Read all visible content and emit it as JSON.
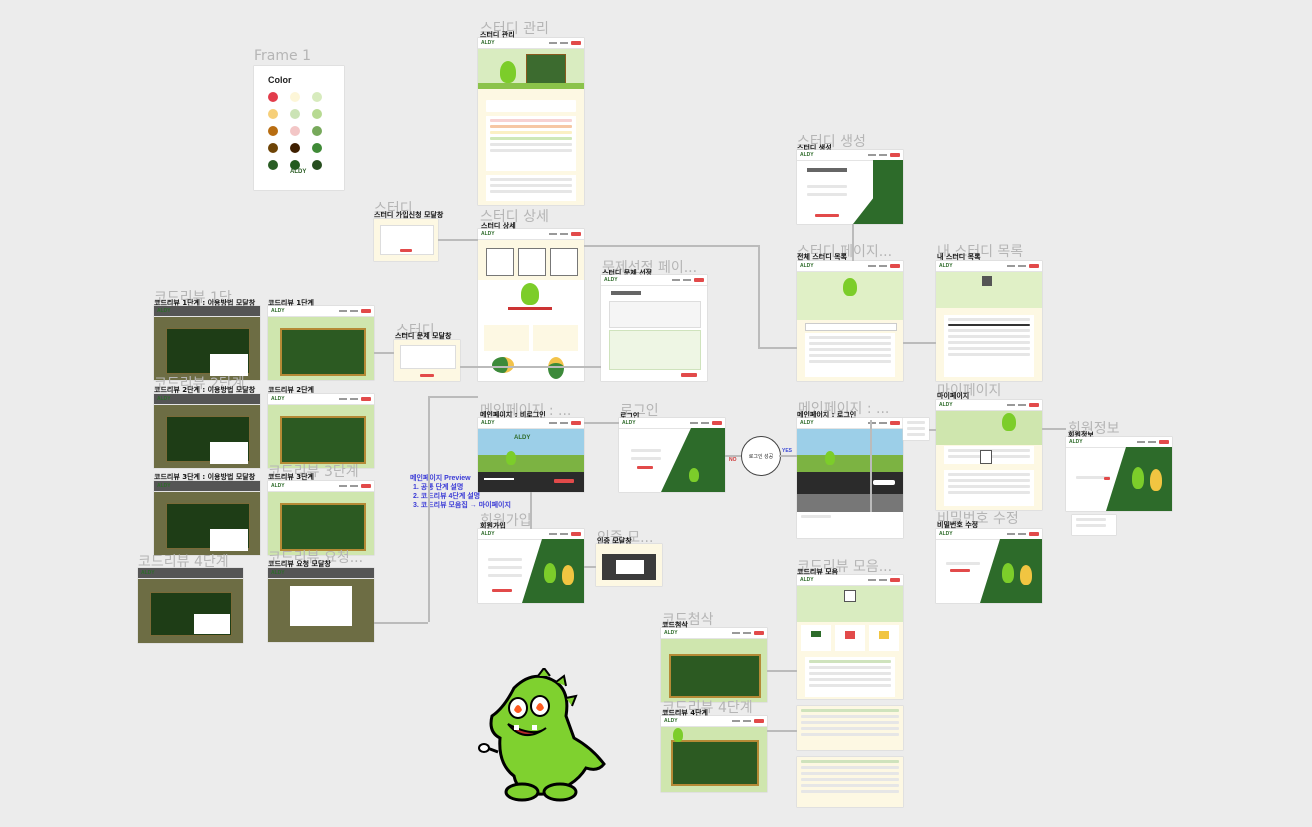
{
  "frame1": {
    "title": "Frame 1",
    "color_label": "Color",
    "brand": "ALDY",
    "swatches": [
      [
        "#e23c4b",
        "#fdf6d8",
        "#d7ebbd"
      ],
      [
        "#f6cf79",
        "#cbe3b5",
        "#b7da92"
      ],
      [
        "#b86d11",
        "#f3c6c6",
        "#77a95b"
      ],
      [
        "#6e4406",
        "#3f1f00",
        "#3f8a36"
      ],
      [
        "#2a5d24",
        "#235a1e",
        "#274e1f"
      ]
    ]
  },
  "ghost": {
    "study_manage": "스터디 관리",
    "study_join": "스터디",
    "study_detail": "스터디 상세",
    "problem_select": "문제선정 페이...",
    "study_create": "스터디 생성",
    "study_page": "스터디 페이지...",
    "my_study": "내 스터디 목록",
    "mypage": "마이페이지",
    "main_before": "메인페이지 : ...",
    "login": "로그인",
    "main_after": "메인페이지 : ...",
    "member_info": "회원정보",
    "signup": "회원가입",
    "auth": "인증 모...",
    "pw": "비밀번호 수정",
    "review_collection": "코드리뷰 모음...",
    "code_review_1": "코드리뷰 1단",
    "code_review_2": "코드리뷰 2단계",
    "code_review_3": "코드리뷰 3단계",
    "code_review_4": "코드리뷰 4단계",
    "code_review_req": "코드리뷰 요청...",
    "study_problem_modal": "스터디",
    "code_edit": "코드첨삭",
    "cr4_bottom": "코드리뷰 4단계"
  },
  "labels": {
    "study_manage": "스터디 관리",
    "study_join_modal": "스터디 가입신청 모달창",
    "study_detail": "스터디 상세",
    "study_problem_select": "스터디 문제 선정",
    "study_create": "스터디 생성",
    "all_study_list": "전체 스터디 목록",
    "my_study_list": "내 스터디 목록",
    "mypage": "마이페이지",
    "main_before_login": "메인페이지 : 비로그인",
    "login": "로그인",
    "main_after_login": "메인페이지 : 로그인",
    "member_info": "회원정보",
    "signup": "회원가입",
    "auth_modal": "인증 모달창",
    "pw_edit": "비밀번호 수정",
    "review_collection": "코드리뷰 모음",
    "cr1_modal": "코드리뷰 1단계 : 이용방법 모달창",
    "cr1": "코드리뷰 1단계",
    "cr2_modal": "코드리뷰 2단계 : 이용방법 모달창",
    "cr2": "코드리뷰 2단계",
    "cr3_modal": "코드리뷰 3단계 : 이용방법 모달창",
    "cr3": "코드리뷰 3단계",
    "cr_req_modal": "코드리뷰 요청 모달창",
    "study_problem_modal": "스터디 문제 모달창",
    "code_edit": "코드첨삭",
    "cr4": "코드리뷰 4단계"
  },
  "notes": {
    "preview_title": "메인페이지 Preview",
    "preview_items": [
      "1. 공통 단계 설명",
      "2. 코드리뷰 4단계 설명",
      "3. 코드리뷰 모음집 → 마이페이지"
    ],
    "login_create": "로그인 성공",
    "yes": "YES",
    "no": "NO"
  },
  "brand": "ALDY"
}
